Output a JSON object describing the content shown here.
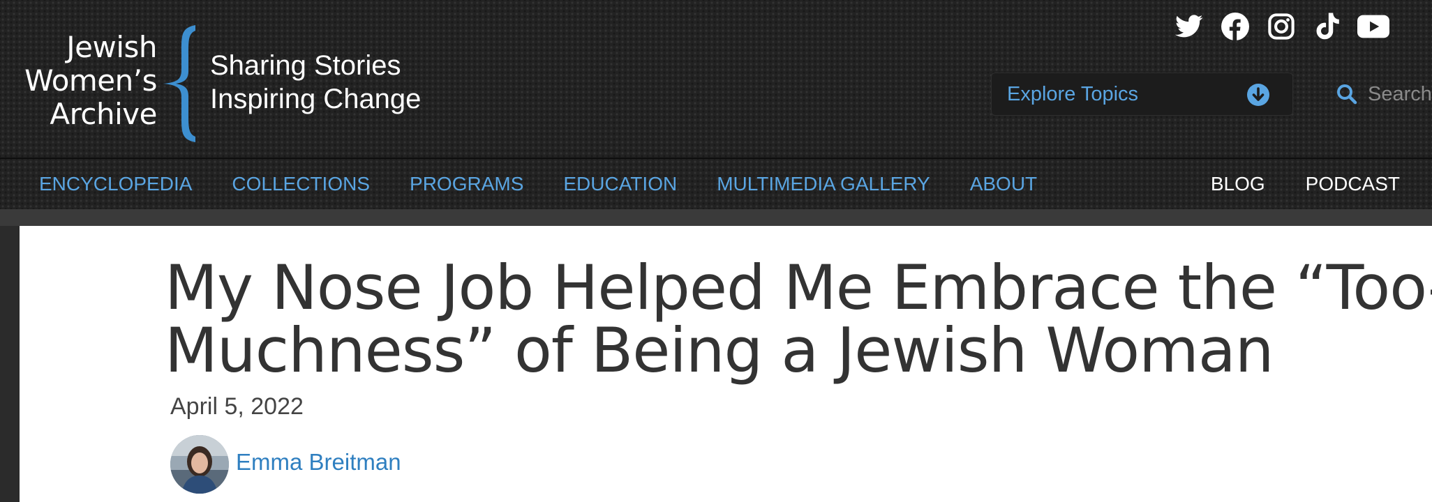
{
  "brand": {
    "name_lines": [
      "Jewish",
      "Women’s",
      "Archive"
    ],
    "tagline_lines": [
      "Sharing Stories",
      "Inspiring Change"
    ]
  },
  "social": [
    "twitter-icon",
    "facebook-icon",
    "instagram-icon",
    "tiktok-icon",
    "youtube-icon"
  ],
  "explore": {
    "label": "Explore Topics"
  },
  "search": {
    "placeholder": "Search"
  },
  "nav": {
    "primary": [
      "ENCYCLOPEDIA",
      "COLLECTIONS",
      "PROGRAMS",
      "EDUCATION",
      "MULTIMEDIA GALLERY",
      "ABOUT"
    ],
    "secondary": [
      "BLOG",
      "PODCAST"
    ]
  },
  "article": {
    "title_lines": [
      "My Nose Job Helped Me Embrace the “Too-",
      "Muchness” of Being a Jewish Woman"
    ],
    "date": "April 5, 2022",
    "author": "Emma Breitman"
  },
  "colors": {
    "accent": "#5aa5e2",
    "brace": "#3d8fd0",
    "author_link": "#2f7fc0",
    "header_bg": "#222222",
    "headline": "#333333"
  }
}
